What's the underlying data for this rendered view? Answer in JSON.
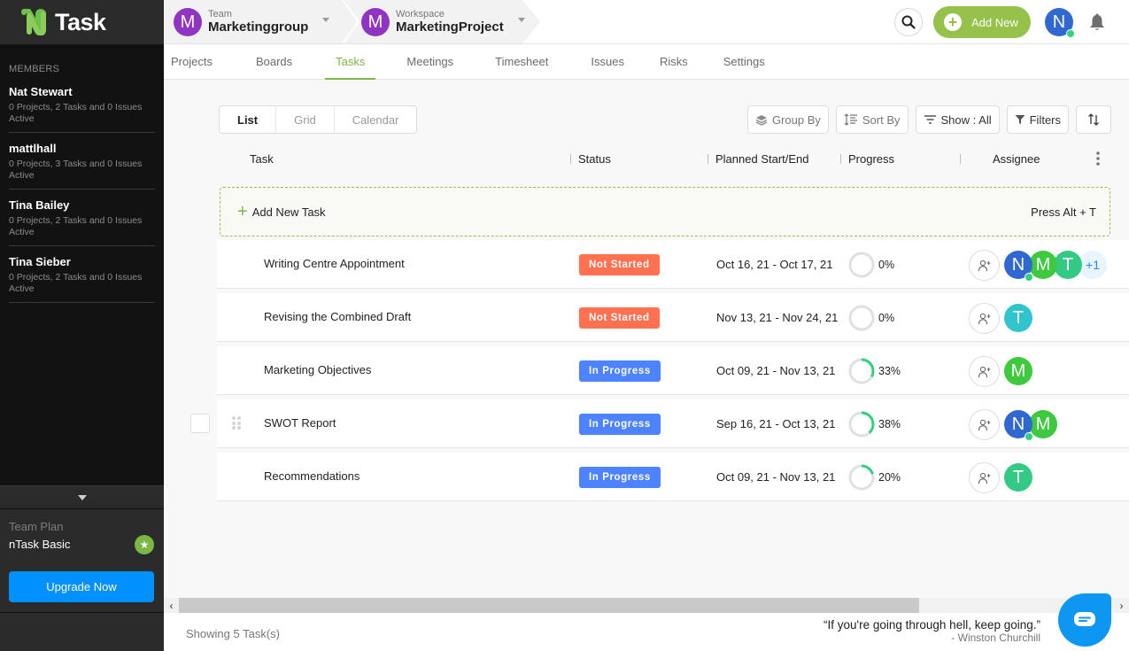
{
  "app": {
    "name": "Task"
  },
  "sidebar": {
    "members_title": "MEMBERS",
    "members": [
      {
        "name": "Nat Stewart",
        "summary": "0 Projects, 2 Tasks and 0 Issues",
        "state": "Active"
      },
      {
        "name": "mattlhall",
        "summary": "0 Projects, 3 Tasks and 0 Issues",
        "state": "Active"
      },
      {
        "name": "Tina Bailey",
        "summary": "0 Projects, 2 Tasks and 0 Issues",
        "state": "Active"
      },
      {
        "name": "Tina Sieber",
        "summary": "0 Projects, 2 Tasks and 0 Issues",
        "state": "Active"
      }
    ],
    "plan": {
      "label": "Team Plan",
      "name": "nTask Basic",
      "star_icon": "★",
      "upgrade_label": "Upgrade Now"
    }
  },
  "header": {
    "team": {
      "label": "Team",
      "value": "Marketinggroup",
      "initial": "M"
    },
    "workspace": {
      "label": "Workspace",
      "value": "MarketingProject",
      "initial": "M"
    },
    "add_new_label": "Add New",
    "add_new_plus": "+",
    "user_initial": "N"
  },
  "tabs": [
    {
      "label": "Projects",
      "active": false
    },
    {
      "label": "Boards",
      "active": false
    },
    {
      "label": "Tasks",
      "active": true
    },
    {
      "label": "Meetings",
      "active": false
    },
    {
      "label": "Timesheet",
      "active": false
    },
    {
      "label": "Issues",
      "active": false
    },
    {
      "label": "Risks",
      "active": false
    },
    {
      "label": "Settings",
      "active": false
    }
  ],
  "views": [
    {
      "label": "List",
      "active": true
    },
    {
      "label": "Grid",
      "active": false
    },
    {
      "label": "Calendar",
      "active": false
    }
  ],
  "toolbar": {
    "group_by": "Group By",
    "sort_by": "Sort By",
    "show": "Show : All",
    "filters": "Filters"
  },
  "columns": {
    "task": "Task",
    "status": "Status",
    "planned": "Planned Start/End",
    "progress": "Progress",
    "assignee": "Assignee"
  },
  "add_task": {
    "label": "Add New Task",
    "hint": "Press Alt + T",
    "plus": "+"
  },
  "colors": {
    "not_started": "#ff7150",
    "in_progress": "#4d83ff",
    "accent": "#7ab745",
    "progress_arc": "#34d07b",
    "progress_track": "#e0e0e0"
  },
  "tasks": [
    {
      "title": "Writing Centre Appointment",
      "status": "Not Started",
      "status_key": "not_started",
      "dates": "Oct 16, 21 - Oct 17, 21",
      "progress": 0,
      "progress_label": "0%",
      "assignees": [
        {
          "initial": "N",
          "color": "#3167d0",
          "online": true
        },
        {
          "initial": "M",
          "color": "#3ec93e"
        },
        {
          "initial": "T",
          "color": "#34c985"
        }
      ],
      "more": "+1"
    },
    {
      "title": "Revising the Combined Draft",
      "status": "Not Started",
      "status_key": "not_started",
      "dates": "Nov 13, 21 - Nov 24, 21",
      "progress": 0,
      "progress_label": "0%",
      "assignees": [
        {
          "initial": "T",
          "color": "#32c4cc"
        }
      ]
    },
    {
      "title": "Marketing Objectives",
      "status": "In Progress",
      "status_key": "in_progress",
      "dates": "Oct 09, 21 - Nov 13, 21",
      "progress": 33,
      "progress_label": "33%",
      "assignees": [
        {
          "initial": "M",
          "color": "#3ec93e"
        }
      ]
    },
    {
      "title": "SWOT Report",
      "status": "In Progress",
      "status_key": "in_progress",
      "dates": "Sep 16, 21 - Oct 13, 21",
      "progress": 38,
      "progress_label": "38%",
      "assignees": [
        {
          "initial": "N",
          "color": "#3167d0",
          "online": true
        },
        {
          "initial": "M",
          "color": "#3ec93e"
        }
      ],
      "hovered": true
    },
    {
      "title": "Recommendations",
      "status": "In Progress",
      "status_key": "in_progress",
      "dates": "Oct 09, 21 - Nov 13, 21",
      "progress": 20,
      "progress_label": "20%",
      "assignees": [
        {
          "initial": "T",
          "color": "#34c985"
        }
      ]
    }
  ],
  "footer": {
    "showing": "Showing 5 Task(s)",
    "quote": "“If you're going through hell, keep going.”",
    "author": "- Winston Churchill"
  }
}
